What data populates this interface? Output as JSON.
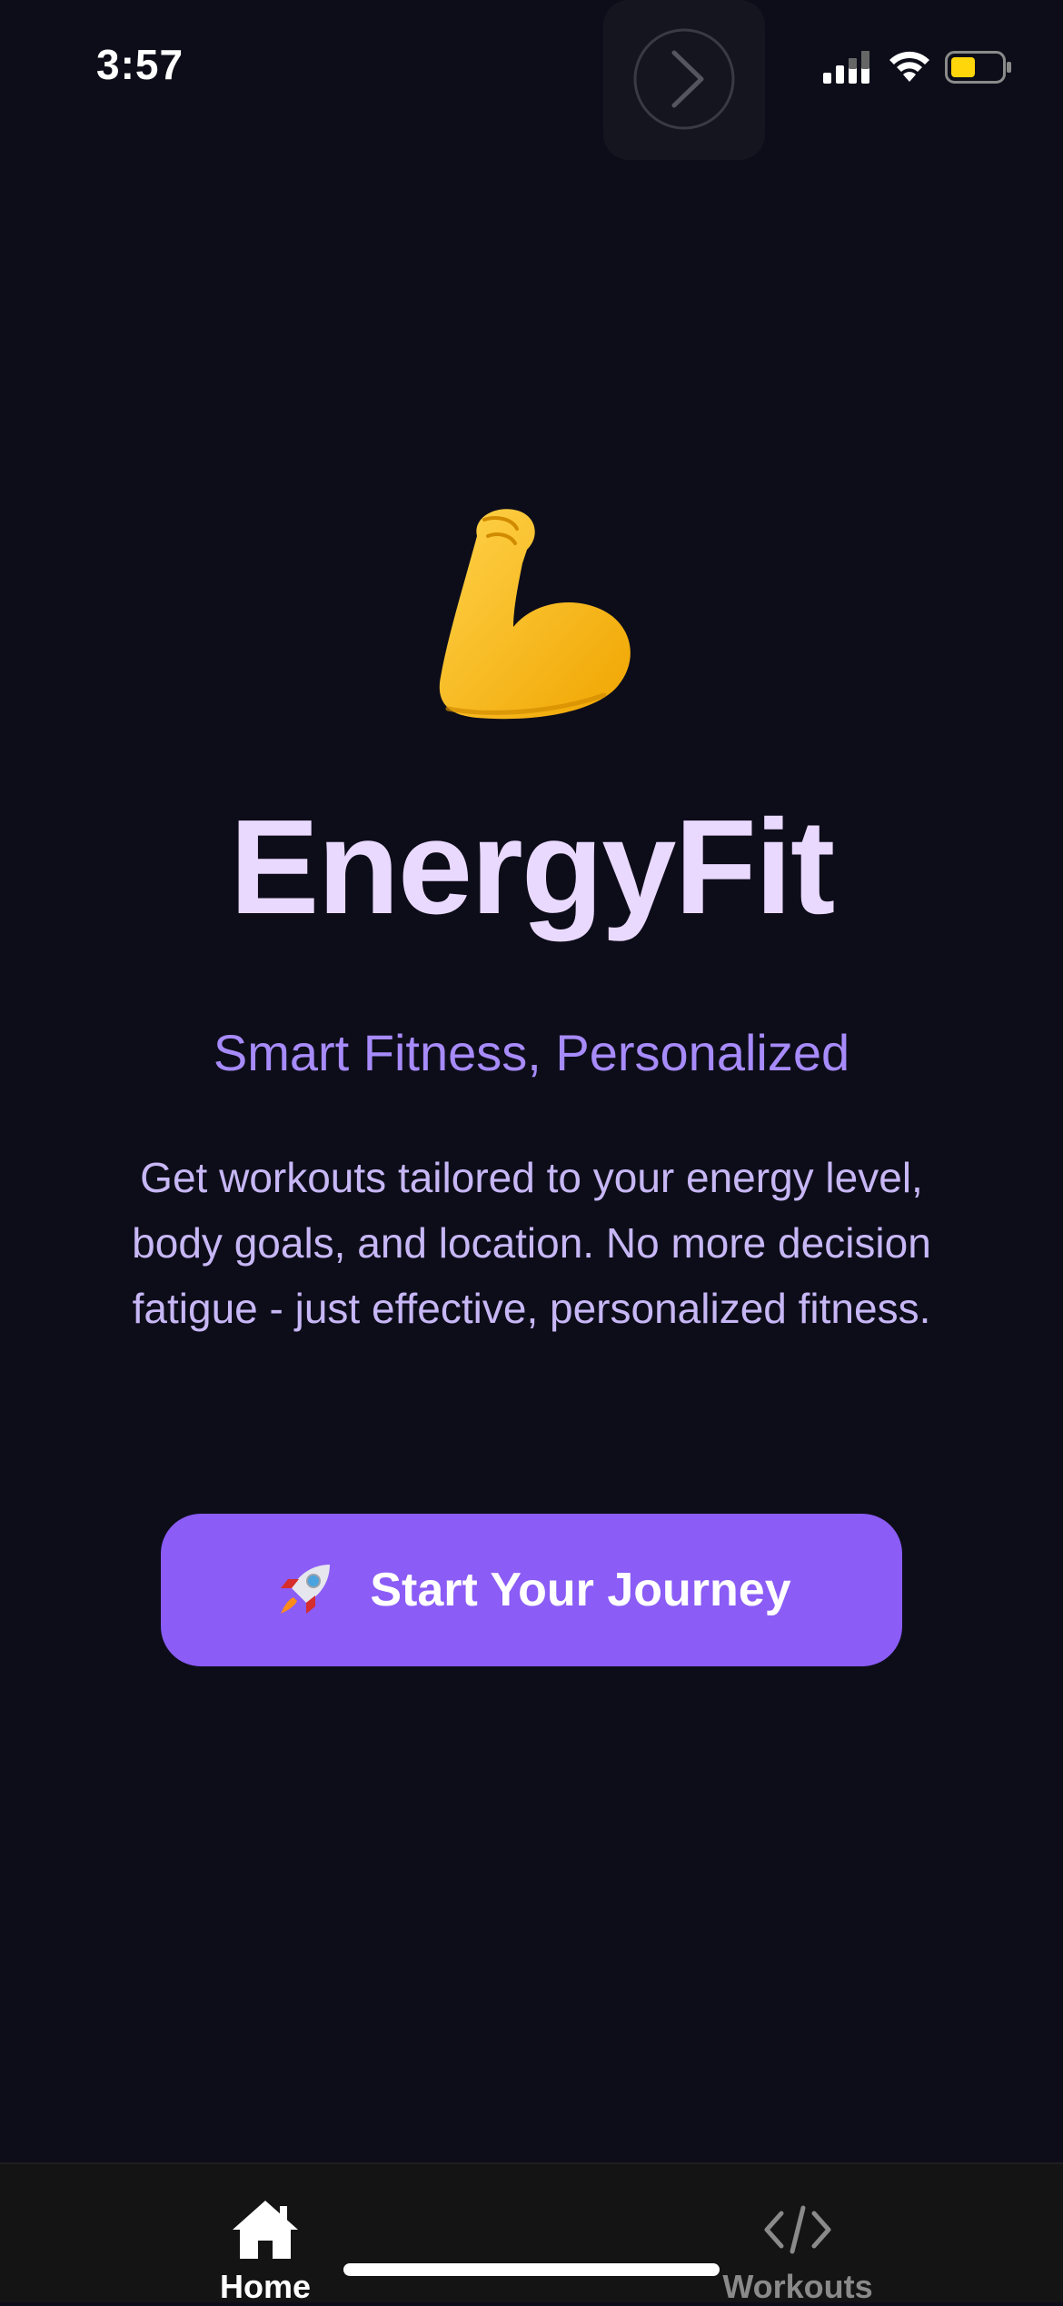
{
  "status_bar": {
    "time": "3:57",
    "icons": [
      "signal-icon",
      "wifi-icon",
      "battery-icon"
    ],
    "battery_color": "#ffd60a"
  },
  "overlay": {
    "icon": "chevron-right-icon"
  },
  "hero": {
    "emoji_icon": "flexed-biceps-icon",
    "title": "EnergyFit",
    "tagline": "Smart Fitness, Personalized",
    "description": "Get workouts tailored to your energy level, body goals, and location. No more decision fatigue - just effective, personalized fitness."
  },
  "cta": {
    "icon": "rocket-icon",
    "label": "Start Your Journey"
  },
  "tabs": [
    {
      "label": "Home",
      "icon": "home-icon",
      "active": true
    },
    {
      "label": "Workouts",
      "icon": "code-icon",
      "active": false
    }
  ],
  "colors": {
    "background": "#0d0d1a",
    "title": "#ead9ff",
    "tagline": "#a78bfa",
    "description": "#c7b7f5",
    "accent": "#8b5cf6",
    "tab_bar": "#141414"
  }
}
